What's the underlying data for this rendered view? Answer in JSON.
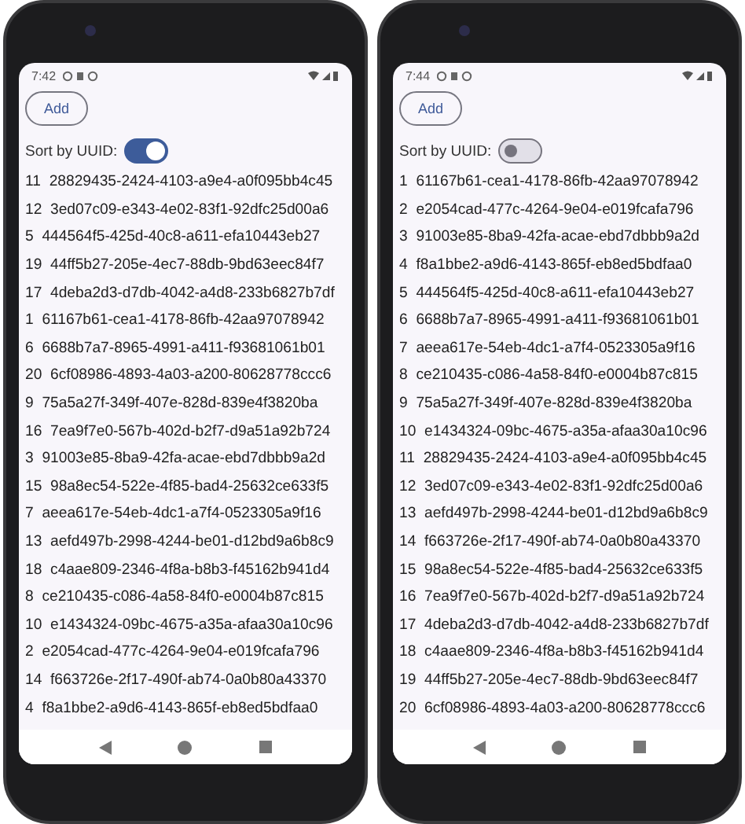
{
  "phones": [
    {
      "status_time": "7:42",
      "add_button": "Add",
      "sort_label": "Sort by UUID:",
      "sort_on": true,
      "rows": [
        {
          "number": "11",
          "uuid": "28829435-2424-4103-a9e4-a0f095bb4c45"
        },
        {
          "number": "12",
          "uuid": "3ed07c09-e343-4e02-83f1-92dfc25d00a6"
        },
        {
          "number": "5",
          "uuid": "444564f5-425d-40c8-a611-efa10443eb27"
        },
        {
          "number": "19",
          "uuid": "44ff5b27-205e-4ec7-88db-9bd63eec84f7"
        },
        {
          "number": "17",
          "uuid": "4deba2d3-d7db-4042-a4d8-233b6827b7df"
        },
        {
          "number": "1",
          "uuid": "61167b61-cea1-4178-86fb-42aa97078942"
        },
        {
          "number": "6",
          "uuid": "6688b7a7-8965-4991-a411-f93681061b01"
        },
        {
          "number": "20",
          "uuid": "6cf08986-4893-4a03-a200-80628778ccc6"
        },
        {
          "number": "9",
          "uuid": "75a5a27f-349f-407e-828d-839e4f3820ba"
        },
        {
          "number": "16",
          "uuid": "7ea9f7e0-567b-402d-b2f7-d9a51a92b724"
        },
        {
          "number": "3",
          "uuid": "91003e85-8ba9-42fa-acae-ebd7dbbb9a2d"
        },
        {
          "number": "15",
          "uuid": "98a8ec54-522e-4f85-bad4-25632ce633f5"
        },
        {
          "number": "7",
          "uuid": "aeea617e-54eb-4dc1-a7f4-0523305a9f16"
        },
        {
          "number": "13",
          "uuid": "aefd497b-2998-4244-be01-d12bd9a6b8c9"
        },
        {
          "number": "18",
          "uuid": "c4aae809-2346-4f8a-b8b3-f45162b941d4"
        },
        {
          "number": "8",
          "uuid": "ce210435-c086-4a58-84f0-e0004b87c815"
        },
        {
          "number": "10",
          "uuid": "e1434324-09bc-4675-a35a-afaa30a10c96"
        },
        {
          "number": "2",
          "uuid": "e2054cad-477c-4264-9e04-e019fcafa796"
        },
        {
          "number": "14",
          "uuid": "f663726e-2f17-490f-ab74-0a0b80a43370"
        },
        {
          "number": "4",
          "uuid": "f8a1bbe2-a9d6-4143-865f-eb8ed5bdfaa0"
        }
      ]
    },
    {
      "status_time": "7:44",
      "add_button": "Add",
      "sort_label": "Sort by UUID:",
      "sort_on": false,
      "rows": [
        {
          "number": "1",
          "uuid": "61167b61-cea1-4178-86fb-42aa97078942"
        },
        {
          "number": "2",
          "uuid": "e2054cad-477c-4264-9e04-e019fcafa796"
        },
        {
          "number": "3",
          "uuid": "91003e85-8ba9-42fa-acae-ebd7dbbb9a2d"
        },
        {
          "number": "4",
          "uuid": "f8a1bbe2-a9d6-4143-865f-eb8ed5bdfaa0"
        },
        {
          "number": "5",
          "uuid": "444564f5-425d-40c8-a611-efa10443eb27"
        },
        {
          "number": "6",
          "uuid": "6688b7a7-8965-4991-a411-f93681061b01"
        },
        {
          "number": "7",
          "uuid": "aeea617e-54eb-4dc1-a7f4-0523305a9f16"
        },
        {
          "number": "8",
          "uuid": "ce210435-c086-4a58-84f0-e0004b87c815"
        },
        {
          "number": "9",
          "uuid": "75a5a27f-349f-407e-828d-839e4f3820ba"
        },
        {
          "number": "10",
          "uuid": "e1434324-09bc-4675-a35a-afaa30a10c96"
        },
        {
          "number": "11",
          "uuid": "28829435-2424-4103-a9e4-a0f095bb4c45"
        },
        {
          "number": "12",
          "uuid": "3ed07c09-e343-4e02-83f1-92dfc25d00a6"
        },
        {
          "number": "13",
          "uuid": "aefd497b-2998-4244-be01-d12bd9a6b8c9"
        },
        {
          "number": "14",
          "uuid": "f663726e-2f17-490f-ab74-0a0b80a43370"
        },
        {
          "number": "15",
          "uuid": "98a8ec54-522e-4f85-bad4-25632ce633f5"
        },
        {
          "number": "16",
          "uuid": "7ea9f7e0-567b-402d-b2f7-d9a51a92b724"
        },
        {
          "number": "17",
          "uuid": "4deba2d3-d7db-4042-a4d8-233b6827b7df"
        },
        {
          "number": "18",
          "uuid": "c4aae809-2346-4f8a-b8b3-f45162b941d4"
        },
        {
          "number": "19",
          "uuid": "44ff5b27-205e-4ec7-88db-9bd63eec84f7"
        },
        {
          "number": "20",
          "uuid": "6cf08986-4893-4a03-a200-80628778ccc6"
        }
      ]
    }
  ]
}
